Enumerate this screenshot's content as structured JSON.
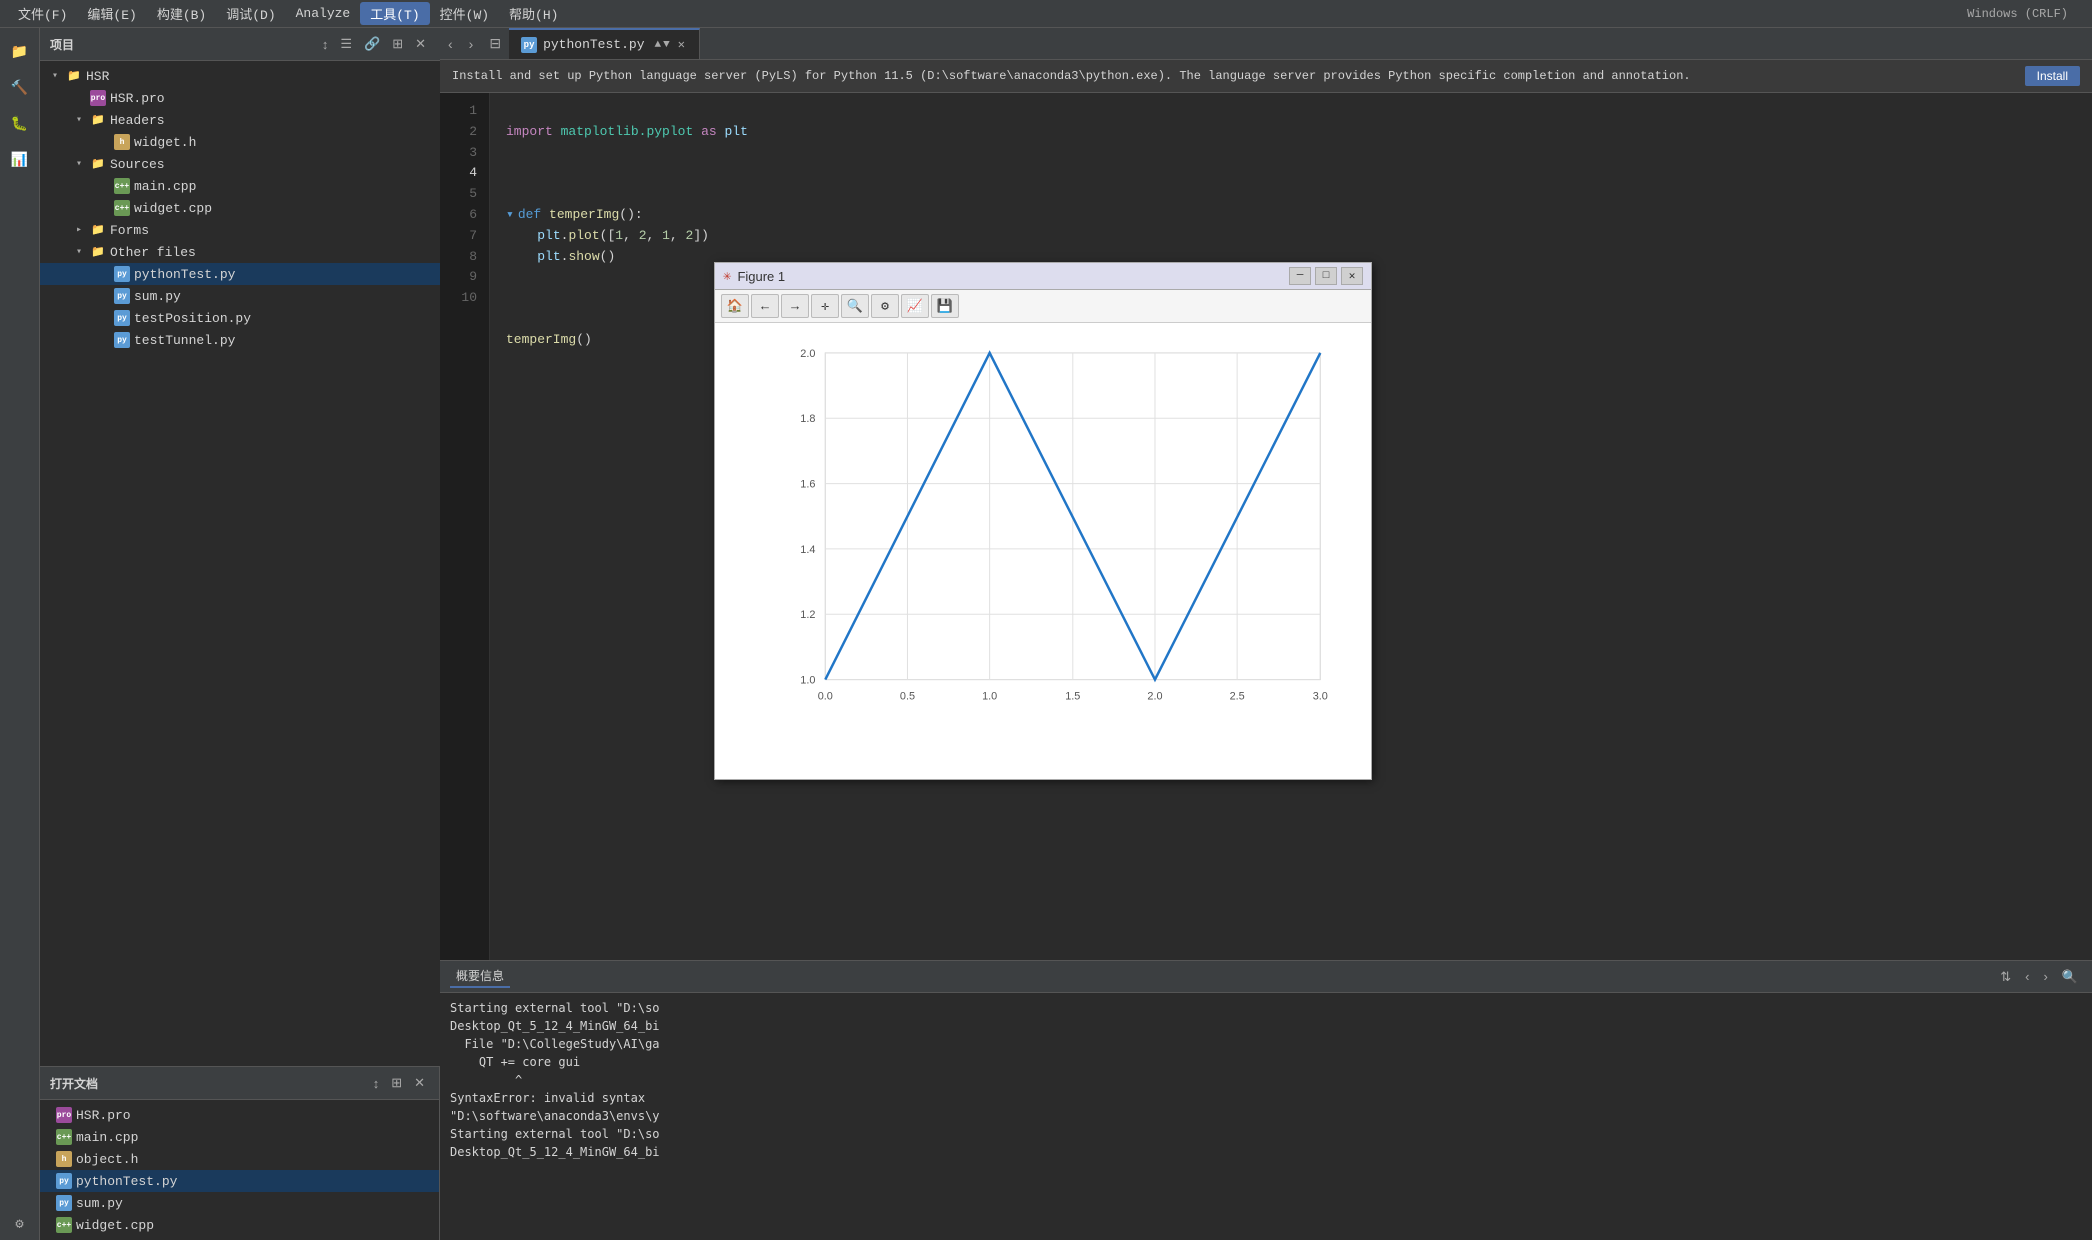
{
  "menubar": {
    "items": [
      {
        "label": "文件(F)",
        "active": false
      },
      {
        "label": "编辑(E)",
        "active": false
      },
      {
        "label": "构建(B)",
        "active": false
      },
      {
        "label": "调试(D)",
        "active": false
      },
      {
        "label": "Analyze",
        "active": false
      },
      {
        "label": "工具(T)",
        "active": true
      },
      {
        "label": "控件(W)",
        "active": false
      },
      {
        "label": "帮助(H)",
        "active": false
      }
    ]
  },
  "toolbar": {
    "windows_label": "Windows (CRLF)"
  },
  "tab": {
    "filename": "pythonTest.py",
    "icon_label": "py"
  },
  "notification": {
    "text": "Install and set up Python language server (PyLS) for Python 11.5 (D:\\software\\anaconda3\\python.exe). The language server provides Python specific completion and annotation.",
    "button_label": "Install"
  },
  "project_panel": {
    "title": "项目",
    "tree": [
      {
        "level": 0,
        "type": "folder",
        "label": "HSR",
        "expanded": true,
        "icon": "folder"
      },
      {
        "level": 1,
        "type": "file",
        "label": "HSR.pro",
        "icon": "pro"
      },
      {
        "level": 1,
        "type": "folder",
        "label": "Headers",
        "expanded": true,
        "icon": "folder"
      },
      {
        "level": 2,
        "type": "file",
        "label": "widget.h",
        "icon": "h"
      },
      {
        "level": 1,
        "type": "folder",
        "label": "Sources",
        "expanded": true,
        "icon": "folder"
      },
      {
        "level": 2,
        "type": "file",
        "label": "main.cpp",
        "icon": "cpp"
      },
      {
        "level": 2,
        "type": "file",
        "label": "widget.cpp",
        "icon": "cpp"
      },
      {
        "level": 1,
        "type": "folder",
        "label": "Forms",
        "expanded": false,
        "icon": "folder"
      },
      {
        "level": 1,
        "type": "folder",
        "label": "Other files",
        "expanded": true,
        "icon": "folder"
      },
      {
        "level": 2,
        "type": "file",
        "label": "pythonTest.py",
        "icon": "py",
        "selected": true
      },
      {
        "level": 2,
        "type": "file",
        "label": "sum.py",
        "icon": "py"
      },
      {
        "level": 2,
        "type": "file",
        "label": "testPosition.py",
        "icon": "py"
      },
      {
        "level": 2,
        "type": "file",
        "label": "testTunnel.py",
        "icon": "py"
      }
    ]
  },
  "code": {
    "lines": [
      {
        "num": 1,
        "content": "import matplotlib.pyplot as plt",
        "active": false
      },
      {
        "num": 2,
        "content": "",
        "active": false
      },
      {
        "num": 3,
        "content": "",
        "active": false
      },
      {
        "num": 4,
        "content": "def temperImg():",
        "active": false
      },
      {
        "num": 5,
        "content": "    plt.plot([1, 2, 1, 2])",
        "active": false
      },
      {
        "num": 6,
        "content": "    plt.show()",
        "active": false
      },
      {
        "num": 7,
        "content": "",
        "active": false
      },
      {
        "num": 8,
        "content": "",
        "active": false
      },
      {
        "num": 9,
        "content": "temperImg()",
        "active": false
      },
      {
        "num": 10,
        "content": "",
        "active": false
      }
    ]
  },
  "figure_window": {
    "title": "Figure 1",
    "toolbar_buttons": [
      "🏠",
      "←",
      "→",
      "✛",
      "🔍",
      "⚙",
      "📈",
      "💾"
    ],
    "chart": {
      "x_labels": [
        "0.0",
        "0.5",
        "1.0",
        "1.5",
        "2.0",
        "2.5",
        "3.0"
      ],
      "y_labels": [
        "1.0",
        "1.2",
        "1.4",
        "1.6",
        "1.8",
        "2.0"
      ],
      "data_points": [
        {
          "x": 0,
          "y": 1
        },
        {
          "x": 1,
          "y": 2
        },
        {
          "x": 2,
          "y": 1
        },
        {
          "x": 3,
          "y": 2
        }
      ],
      "color": "#2176c7"
    }
  },
  "output_panel": {
    "tab_label": "概要信息",
    "content_lines": [
      "Starting external tool \"D:\\so",
      "Desktop_Qt_5_12_4_MinGW_64_bi",
      "  File \"D:\\CollegeStudy\\AI\\ga",
      "    QT += core gui",
      "         ^",
      "SyntaxError: invalid syntax",
      "",
      "\"D:\\software\\anaconda3\\envs\\y",
      "Starting external tool \"D:\\so",
      "Desktop_Qt_5_12_4_MinGW_64_bi"
    ]
  },
  "open_docs_panel": {
    "title": "打开文档",
    "files": [
      {
        "label": "HSR.pro",
        "icon": "pro"
      },
      {
        "label": "main.cpp",
        "icon": "cpp"
      },
      {
        "label": "object.h",
        "icon": "h"
      },
      {
        "label": "pythonTest.py",
        "icon": "py",
        "selected": true
      },
      {
        "label": "sum.py",
        "icon": "py"
      },
      {
        "label": "widget.cpp",
        "icon": "cpp"
      }
    ]
  }
}
